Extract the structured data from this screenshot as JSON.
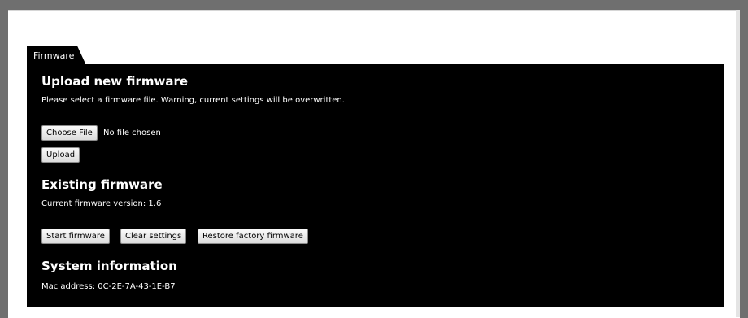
{
  "tab": {
    "label": "Firmware"
  },
  "upload": {
    "heading": "Upload new firmware",
    "description": "Please select a firmware file. Warning, current settings will be overwritten.",
    "choose_file_label": "Choose File",
    "file_status": "No file chosen",
    "upload_label": "Upload"
  },
  "existing": {
    "heading": "Existing firmware",
    "version_text": "Current firmware version: 1.6",
    "start_label": "Start firmware",
    "clear_label": "Clear settings",
    "restore_label": "Restore factory firmware"
  },
  "system": {
    "heading": "System information",
    "mac_text": "Mac address: 0C-2E-7A-43-1E-B7"
  }
}
